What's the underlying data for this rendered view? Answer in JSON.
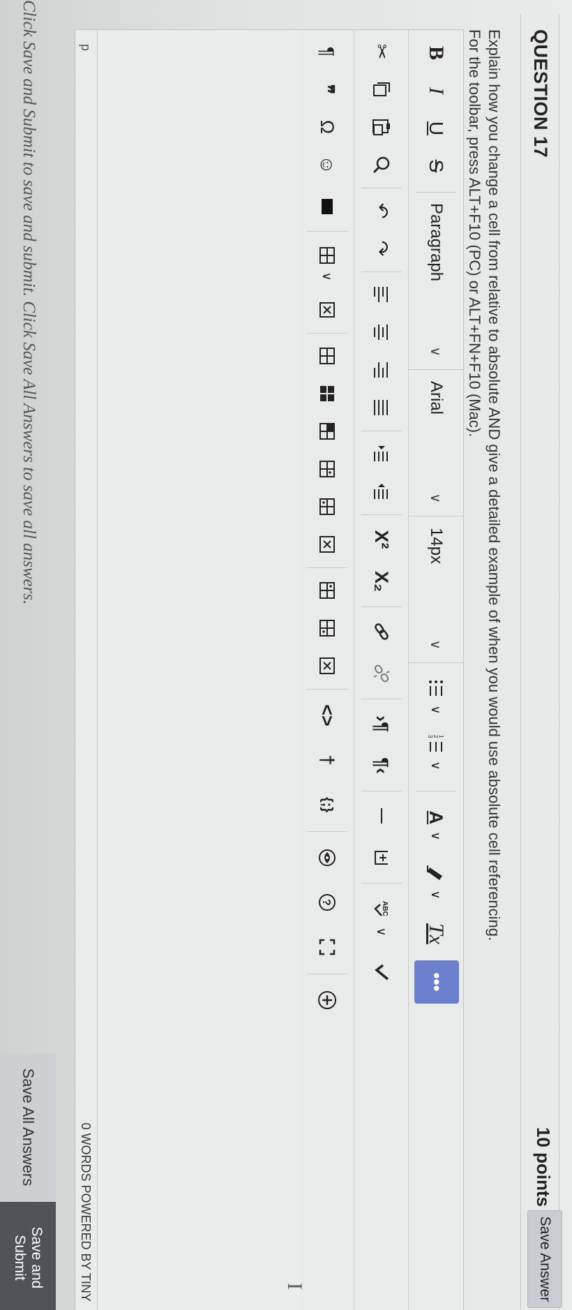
{
  "question": {
    "title": "QUESTION 17",
    "points": "10 points",
    "save_answer_label": "Save Answer",
    "prompt_line1": "Explain how you change a cell from relative to absolute AND give a detailed example of when you would use absolute cell referencing.",
    "prompt_line2": "For the toolbar, press ALT+F10 (PC) or ALT+FN+F10 (Mac)."
  },
  "toolbar": {
    "block_format": "Paragraph",
    "font_family": "Arial",
    "font_size": "14px",
    "more_label": "•••",
    "icons_row1": [
      "bold-icon",
      "italic-icon",
      "underline-icon",
      "strikethrough-icon",
      "bullet-list-icon",
      "numbered-list-icon",
      "text-color-icon",
      "highlight-color-icon",
      "clear-formatting-icon"
    ],
    "icons_row2": [
      "cut-icon",
      "copy-icon",
      "paste-icon",
      "search-icon",
      "undo-icon",
      "redo-icon",
      "align-left-icon",
      "align-center-icon",
      "align-right-icon",
      "justify-icon",
      "indent-icon",
      "outdent-icon",
      "superscript-icon",
      "subscript-icon",
      "link-icon",
      "unlink-icon",
      "ltr-icon",
      "rtl-icon",
      "horizontal-line-icon",
      "insert-box-icon",
      "spellcheck-icon",
      "check-icon"
    ],
    "icons_row3": [
      "paragraph-mark-icon",
      "blockquote-icon",
      "special-char-icon",
      "emoticon-icon",
      "media-icon",
      "table-icon",
      "table-delete-icon",
      "table-cell-icon",
      "table-merge-icon",
      "table-row-icon",
      "table-insert-row-icon",
      "table-delete-row-icon",
      "table-insert-col-icon",
      "table-col-after-icon",
      "table-delete-col-icon",
      "source-code-icon",
      "anchor-icon",
      "code-block-icon",
      "preview-icon",
      "help-icon",
      "fullscreen-icon",
      "add-content-icon"
    ],
    "labels": {
      "bold": "B",
      "italic": "I",
      "underline": "U",
      "strike": "S",
      "text_color": "A",
      "clear_fmt": "Tx",
      "superscript": "X²",
      "subscript": "X₂",
      "para_mark": "¶",
      "quote": "❞",
      "omega": "Ω",
      "code": "<>",
      "braces": "{;}",
      "help": "?"
    }
  },
  "editor": {
    "path": "p",
    "word_count": "0 WORDS",
    "powered_by": "POWERED BY TINY"
  },
  "footer": {
    "instruction": "Click Save and Submit to save and submit. Click Save All Answers to save all answers.",
    "save_all_label": "Save All Answers",
    "save_submit_label": "Save and Submit"
  }
}
